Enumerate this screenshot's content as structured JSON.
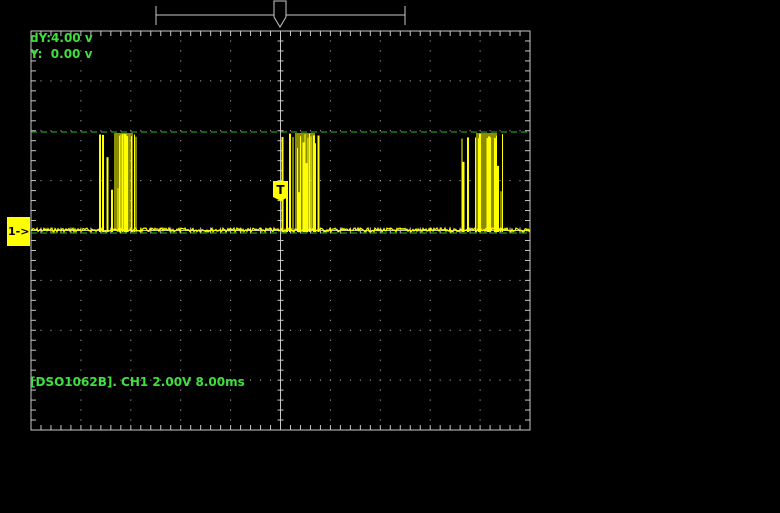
{
  "instrument": {
    "model_label": "DSO1062B"
  },
  "cursor_readout": {
    "dy": "dY:4.00 v",
    "y": "Y:  0.00 v"
  },
  "status_line": "[DSO1062B]. CH1 2.00V 8.00ms",
  "channel_marker": {
    "label": "1->",
    "color": "#ffff00"
  },
  "trigger": {
    "flag_label": "T",
    "position_label": "T"
  },
  "colors": {
    "background": "#000000",
    "grid": "#c8c8c8",
    "trace": "#ffff00",
    "cursor_line": "#1fc01f",
    "readout_text": "#3ee03e"
  },
  "icons": {
    "trigger_position_marker": "trigger-position-icon",
    "trigger_level_flag": "trigger-flag-icon"
  }
}
